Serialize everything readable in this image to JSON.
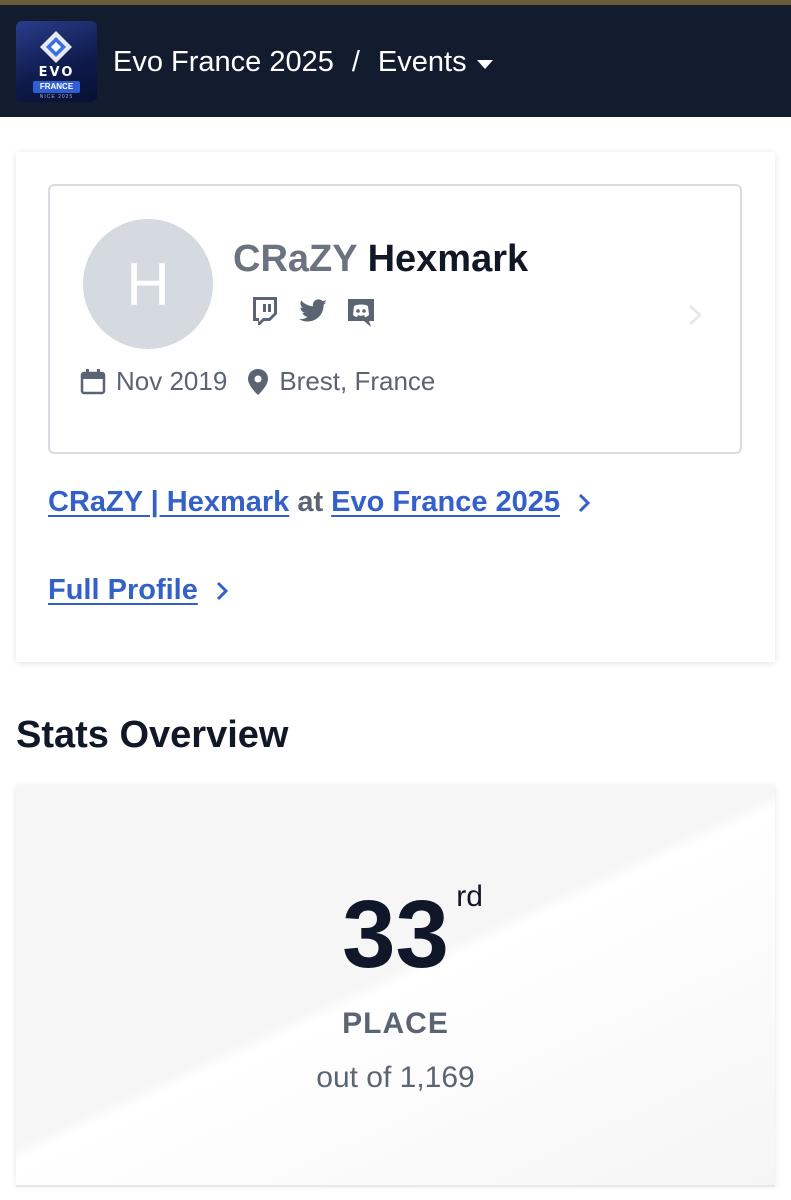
{
  "header": {
    "logo": {
      "text": "EVO",
      "badge": "FRANCE",
      "sub": "NICE 2025"
    },
    "event_name": "Evo France 2025",
    "separator": "/",
    "section": "Events"
  },
  "profile": {
    "avatar_initial": "H",
    "prefix": "CRaZY",
    "gamer_tag": "Hexmark",
    "socials": [
      "twitch-icon",
      "twitter-icon",
      "discord-icon"
    ],
    "joined": "Nov 2019",
    "location": "Brest, France"
  },
  "links": {
    "player_event": {
      "player": "CRaZY | Hexmark",
      "at": "at",
      "event": "Evo France 2025"
    },
    "full_profile": "Full Profile"
  },
  "stats": {
    "title": "Stats Overview",
    "placement": "33",
    "suffix": "rd",
    "label": "PLACE",
    "total": "out of 1,169"
  },
  "colors": {
    "header_bg": "#131b2e",
    "link": "#3461c9",
    "muted": "#5b6473"
  }
}
